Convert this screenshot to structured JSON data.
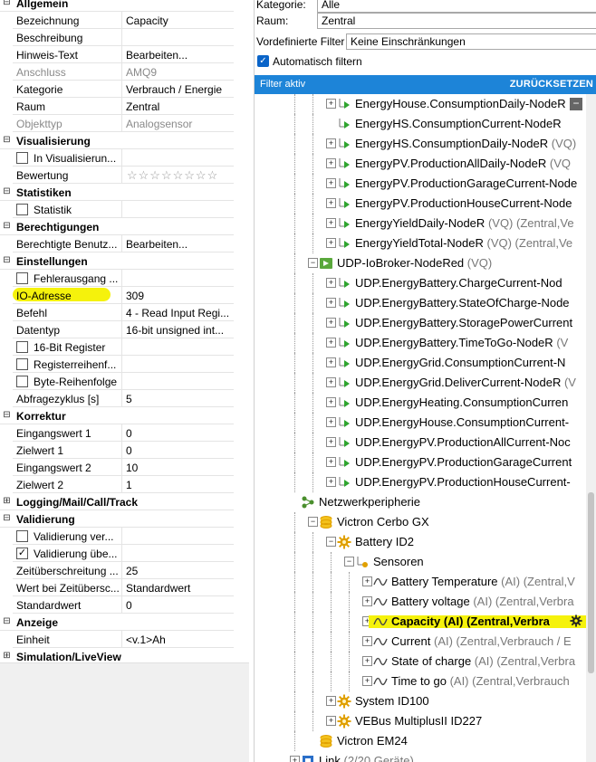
{
  "props": {
    "rows": [
      {
        "kind": "category",
        "name": "Allgemein",
        "state": "expanded"
      },
      {
        "kind": "prop",
        "name": "Bezeichnung",
        "value": "Capacity"
      },
      {
        "kind": "prop",
        "name": "Beschreibung",
        "value": ""
      },
      {
        "kind": "prop",
        "name": "Hinweis-Text",
        "value": "Bearbeiten..."
      },
      {
        "kind": "prop",
        "name": "Anschluss",
        "value": "AMQ9",
        "readonly": true
      },
      {
        "kind": "prop",
        "name": "Kategorie",
        "value": "Verbrauch / Energie"
      },
      {
        "kind": "prop",
        "name": "Raum",
        "value": "Zentral"
      },
      {
        "kind": "prop",
        "name": "Objekttyp",
        "value": "Analogsensor",
        "readonly": true
      },
      {
        "kind": "category",
        "name": "Visualisierung",
        "state": "expanded"
      },
      {
        "kind": "check",
        "name": "In Visualisierun...",
        "checked": false,
        "value": ""
      },
      {
        "kind": "stars",
        "name": "Bewertung",
        "rating": 0
      },
      {
        "kind": "category",
        "name": "Statistiken",
        "state": "expanded"
      },
      {
        "kind": "check",
        "name": "Statistik",
        "checked": false,
        "value": ""
      },
      {
        "kind": "category",
        "name": "Berechtigungen",
        "state": "expanded"
      },
      {
        "kind": "prop",
        "name": "Berechtigte Benutz...",
        "value": "Bearbeiten..."
      },
      {
        "kind": "category",
        "name": "Einstellungen",
        "state": "expanded"
      },
      {
        "kind": "check",
        "name": "Fehlerausgang ...",
        "checked": false,
        "value": ""
      },
      {
        "kind": "prop",
        "name": "IO-Adresse",
        "value": "309",
        "highlight": true
      },
      {
        "kind": "prop",
        "name": "Befehl",
        "value": "4 - Read Input Regi..."
      },
      {
        "kind": "prop",
        "name": "Datentyp",
        "value": "16-bit unsigned int..."
      },
      {
        "kind": "check",
        "name": "16-Bit Register",
        "checked": false,
        "value": ""
      },
      {
        "kind": "check",
        "name": "Registerreihenf...",
        "checked": false,
        "value": ""
      },
      {
        "kind": "check",
        "name": "Byte-Reihenfolge",
        "checked": false,
        "value": ""
      },
      {
        "kind": "prop",
        "name": "Abfragezyklus [s]",
        "value": "5"
      },
      {
        "kind": "category",
        "name": "Korrektur",
        "state": "expanded"
      },
      {
        "kind": "prop",
        "name": "Eingangswert 1",
        "value": "0"
      },
      {
        "kind": "prop",
        "name": "Zielwert 1",
        "value": "0"
      },
      {
        "kind": "prop",
        "name": "Eingangswert 2",
        "value": "10"
      },
      {
        "kind": "prop",
        "name": "Zielwert 2",
        "value": "1"
      },
      {
        "kind": "category",
        "name": "Logging/Mail/Call/Track",
        "state": "collapsed"
      },
      {
        "kind": "category",
        "name": "Validierung",
        "state": "expanded"
      },
      {
        "kind": "check",
        "name": "Validierung ver...",
        "checked": false,
        "value": ""
      },
      {
        "kind": "check",
        "name": "Validierung übe...",
        "checked": true,
        "value": ""
      },
      {
        "kind": "prop",
        "name": "Zeitüberschreitung ...",
        "value": "25"
      },
      {
        "kind": "prop",
        "name": "Wert bei Zeitübersc...",
        "value": "Standardwert"
      },
      {
        "kind": "prop",
        "name": "Standardwert",
        "value": "0"
      },
      {
        "kind": "category",
        "name": "Anzeige",
        "state": "expanded"
      },
      {
        "kind": "prop",
        "name": "Einheit",
        "value": "<v.1>Ah"
      },
      {
        "kind": "category",
        "name": "Simulation/LiveView",
        "state": "collapsed"
      }
    ]
  },
  "filters": {
    "kategorie_label": "Kategorie:",
    "kategorie_value": "Alle",
    "raum_label": "Raum:",
    "raum_value": "Zentral",
    "vordef_label": "Vordefinierte Filter",
    "vordef_value": "Keine Einschränkungen",
    "auto_filter_label": "Automatisch filtern",
    "auto_filter_checked": true,
    "filter_bar_label": "Filter aktiv",
    "reset_label": "ZURÜCKSETZEN"
  },
  "tree": {
    "rows": [
      {
        "depth": 2,
        "icon": "virtual-sensor",
        "toggle": "plus",
        "label": "EnergyHouse.ConsumptionDaily-NodeR",
        "sub": ""
      },
      {
        "depth": 2,
        "icon": "virtual-sensor",
        "toggle": "none",
        "label": "EnergyHS.ConsumptionCurrent-NodeR",
        "sub": ""
      },
      {
        "depth": 2,
        "icon": "virtual-sensor",
        "toggle": "plus",
        "label": "EnergyHS.ConsumptionDaily-NodeR",
        "sub": "(VQ)"
      },
      {
        "depth": 2,
        "icon": "virtual-sensor",
        "toggle": "plus",
        "label": "EnergyPV.ProductionAllDaily-NodeR",
        "sub": "(VQ"
      },
      {
        "depth": 2,
        "icon": "virtual-sensor",
        "toggle": "plus",
        "label": "EnergyPV.ProductionGarageCurrent-Node",
        "sub": ""
      },
      {
        "depth": 2,
        "icon": "virtual-sensor",
        "toggle": "plus",
        "label": "EnergyPV.ProductionHouseCurrent-Node",
        "sub": ""
      },
      {
        "depth": 2,
        "icon": "virtual-sensor",
        "toggle": "plus",
        "label": "EnergyYieldDaily-NodeR",
        "sub": "(VQ) (Zentral,Ve"
      },
      {
        "depth": 2,
        "icon": "virtual-sensor",
        "toggle": "plus",
        "label": "EnergyYieldTotal-NodeR",
        "sub": "(VQ) (Zentral,Ve"
      },
      {
        "depth": 1,
        "icon": "udp-gateway",
        "toggle": "minus",
        "label": "UDP-IoBroker-NodeRed",
        "sub": "(VQ)"
      },
      {
        "depth": 2,
        "icon": "virtual-sensor",
        "toggle": "plus",
        "label": "UDP.EnergyBattery.ChargeCurrent-Nod",
        "sub": ""
      },
      {
        "depth": 2,
        "icon": "virtual-sensor",
        "toggle": "plus",
        "label": "UDP.EnergyBattery.StateOfCharge-Node",
        "sub": ""
      },
      {
        "depth": 2,
        "icon": "virtual-sensor",
        "toggle": "plus",
        "label": "UDP.EnergyBattery.StoragePowerCurrent",
        "sub": ""
      },
      {
        "depth": 2,
        "icon": "virtual-sensor",
        "toggle": "plus",
        "label": "UDP.EnergyBattery.TimeToGo-NodeR",
        "sub": "(V"
      },
      {
        "depth": 2,
        "icon": "virtual-sensor",
        "toggle": "plus",
        "label": "UDP.EnergyGrid.ConsumptionCurrent-N",
        "sub": ""
      },
      {
        "depth": 2,
        "icon": "virtual-sensor",
        "toggle": "plus",
        "label": "UDP.EnergyGrid.DeliverCurrent-NodeR",
        "sub": "(V"
      },
      {
        "depth": 2,
        "icon": "virtual-sensor",
        "toggle": "plus",
        "label": "UDP.EnergyHeating.ConsumptionCurren",
        "sub": ""
      },
      {
        "depth": 2,
        "icon": "virtual-sensor",
        "toggle": "plus",
        "label": "UDP.EnergyHouse.ConsumptionCurrent-",
        "sub": ""
      },
      {
        "depth": 2,
        "icon": "virtual-sensor",
        "toggle": "plus",
        "label": "UDP.EnergyPV.ProductionAllCurrent-Noc",
        "sub": ""
      },
      {
        "depth": 2,
        "icon": "virtual-sensor",
        "toggle": "plus",
        "label": "UDP.EnergyPV.ProductionGarageCurrent",
        "sub": ""
      },
      {
        "depth": 2,
        "icon": "virtual-sensor",
        "toggle": "plus",
        "label": "UDP.EnergyPV.ProductionHouseCurrent-",
        "sub": ""
      },
      {
        "depth": 0,
        "icon": "network",
        "toggle": "none",
        "label": "Netzwerkperipherie",
        "sub": ""
      },
      {
        "depth": 1,
        "icon": "device",
        "toggle": "minus",
        "label": "Victron Cerbo GX",
        "sub": ""
      },
      {
        "depth": 2,
        "icon": "module",
        "toggle": "minus",
        "label": "Battery ID2",
        "sub": ""
      },
      {
        "depth": 3,
        "icon": "sensor-folder",
        "toggle": "minus",
        "label": "Sensoren",
        "sub": ""
      },
      {
        "depth": 4,
        "icon": "analog-sensor",
        "toggle": "plus",
        "label": "Battery Temperature",
        "sub": "(AI) (Zentral,V"
      },
      {
        "depth": 4,
        "icon": "analog-sensor",
        "toggle": "plus",
        "label": "Battery voltage",
        "sub": "(AI) (Zentral,Verbra"
      },
      {
        "depth": 4,
        "icon": "analog-sensor",
        "toggle": "plus",
        "label": "Capacity",
        "sub": "(AI) (Zentral,Verbra",
        "selected": true
      },
      {
        "depth": 4,
        "icon": "analog-sensor",
        "toggle": "plus",
        "label": "Current",
        "sub": "(AI) (Zentral,Verbrauch / E"
      },
      {
        "depth": 4,
        "icon": "analog-sensor",
        "toggle": "plus",
        "label": "State of charge",
        "sub": "(AI) (Zentral,Verbra"
      },
      {
        "depth": 4,
        "icon": "analog-sensor",
        "toggle": "plus",
        "label": "Time to go",
        "sub": "(AI) (Zentral,Verbrauch"
      },
      {
        "depth": 2,
        "icon": "module",
        "toggle": "plus",
        "label": "System ID100",
        "sub": ""
      },
      {
        "depth": 2,
        "icon": "module",
        "toggle": "plus",
        "label": "VEBus MultiplusII ID227",
        "sub": ""
      },
      {
        "depth": 1,
        "icon": "device",
        "toggle": "none",
        "label": "Victron EM24",
        "sub": ""
      },
      {
        "depth": 0,
        "icon": "link",
        "toggle": "plus",
        "label": "Link",
        "sub": "(2/20 Geräte)"
      }
    ]
  },
  "colors": {
    "accent": "#1d84d8",
    "highlight": "#f5f20c",
    "sensor_green": "#2fa52f",
    "gateway_green": "#5aa83c",
    "device_gold": "#e0a000"
  }
}
